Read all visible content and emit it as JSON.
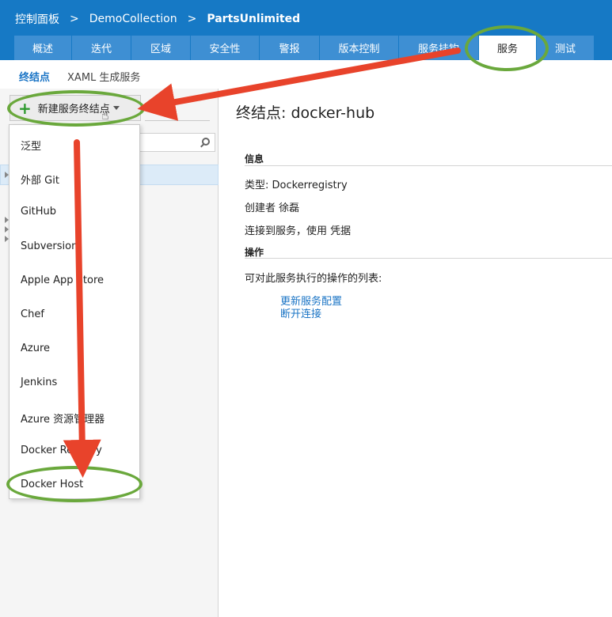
{
  "breadcrumb": {
    "items": [
      "控制面板",
      "DemoCollection",
      "PartsUnlimited"
    ],
    "separator": ">"
  },
  "tabs": [
    "概述",
    "迭代",
    "区域",
    "安全性",
    "警报",
    "版本控制",
    "服务挂钩",
    "服务",
    "测试"
  ],
  "active_tab": "服务",
  "subnav": {
    "endpoints": "终结点",
    "xaml": "XAML 生成服务"
  },
  "new_endpoint_button": "新建服务终结点",
  "dropdown_items": [
    "泛型",
    "外部 Git",
    "GitHub",
    "Subversion",
    "Apple App Store",
    "Chef",
    "Azure",
    "Jenkins",
    "Azure 资源管理器",
    "Docker Registry",
    "Docker Host"
  ],
  "content": {
    "title": "终结点: docker-hub",
    "info_heading": "信息",
    "type_line": "类型: Dockerregistry",
    "creator_line": "创建者 徐磊",
    "connect_line": "连接到服务，使用 凭据",
    "actions_heading": "操作",
    "actions_desc": "可对此服务执行的操作的列表:",
    "link_update": "更新服务配置",
    "link_disconnect": "断开连接"
  },
  "colors": {
    "brand_blue": "#1679c5",
    "tab_blue": "#3e8fd3",
    "link_blue": "#1a74c5",
    "annotation_green": "#6aa83c",
    "annotation_red": "#e8432b"
  },
  "icons": {
    "plus": "plus-icon",
    "caret": "chevron-down-icon",
    "search": "search-icon",
    "cursor": "hand-cursor-icon"
  }
}
